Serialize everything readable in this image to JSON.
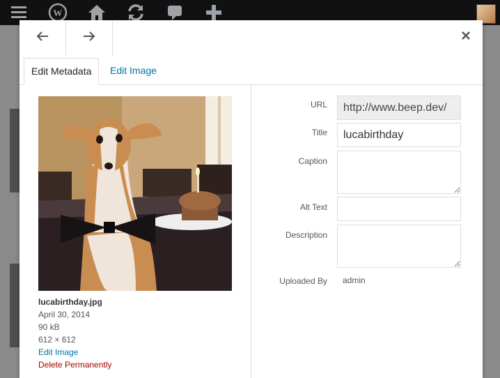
{
  "adminbar": {
    "icons": [
      "menu-icon",
      "wordpress-icon",
      "home-icon",
      "updates-icon",
      "comments-icon",
      "new-icon"
    ]
  },
  "modal": {
    "nav": {
      "prev_icon": "arrow-left-icon",
      "next_icon": "arrow-right-icon",
      "close_icon": "close-icon"
    },
    "tabs": [
      {
        "label": "Edit Metadata",
        "active": true
      },
      {
        "label": "Edit Image",
        "active": false
      }
    ],
    "attachment": {
      "filename": "lucabirthday.jpg",
      "date": "April 30, 2014",
      "filesize": "90 kB",
      "dimensions": "612 × 612",
      "edit_link": "Edit Image",
      "delete_link": "Delete Permanently"
    },
    "fields": {
      "url_label": "URL",
      "url_value": "http://www.beep.dev/",
      "title_label": "Title",
      "title_value": "lucabirthday",
      "caption_label": "Caption",
      "caption_value": "",
      "alt_label": "Alt Text",
      "alt_value": "",
      "description_label": "Description",
      "description_value": "",
      "uploaded_by_label": "Uploaded By",
      "uploaded_by_value": "admin"
    }
  },
  "colors": {
    "link": "#0073aa",
    "delete": "#aa0000",
    "adminbar": "#111111"
  }
}
